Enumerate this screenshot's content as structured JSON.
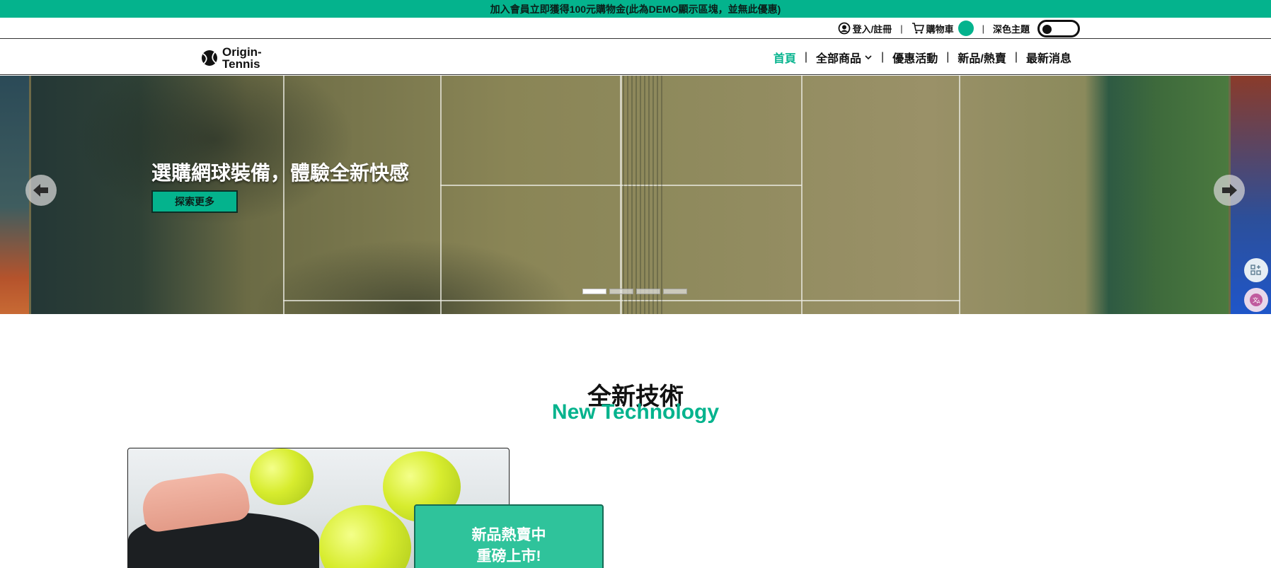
{
  "announcement": "加入會員立即獲得100元購物金(此為DEMO顯示區塊，並無此優惠)",
  "utility": {
    "login_label": "登入/註冊",
    "cart_label": "購物車",
    "dark_theme_label": "深色主題"
  },
  "logo": {
    "line1": "Origin-",
    "line2": "Tennis"
  },
  "nav": {
    "home": "首頁",
    "all_products": "全部商品",
    "promotions": "優惠活動",
    "new_hot": "新品/熱賣",
    "news": "最新消息"
  },
  "hero": {
    "title": "選購網球裝備，體驗全新快感",
    "cta": "探索更多",
    "slide_count": 4,
    "active_slide": 1
  },
  "section": {
    "title_zh": "全新技術",
    "title_en": "New Technology",
    "badge_line1": "新品熱賣中",
    "badge_line2": "重磅上市!"
  },
  "colors": {
    "accent": "#04b38d",
    "badge": "#2fc39b"
  },
  "icons": {
    "login": "user-circle-icon",
    "cart": "cart-icon",
    "dropdown": "chevron-down-icon",
    "prev": "arrow-left-icon",
    "next": "arrow-right-icon",
    "float1": "grid-add-icon",
    "float2": "translate-icon"
  }
}
